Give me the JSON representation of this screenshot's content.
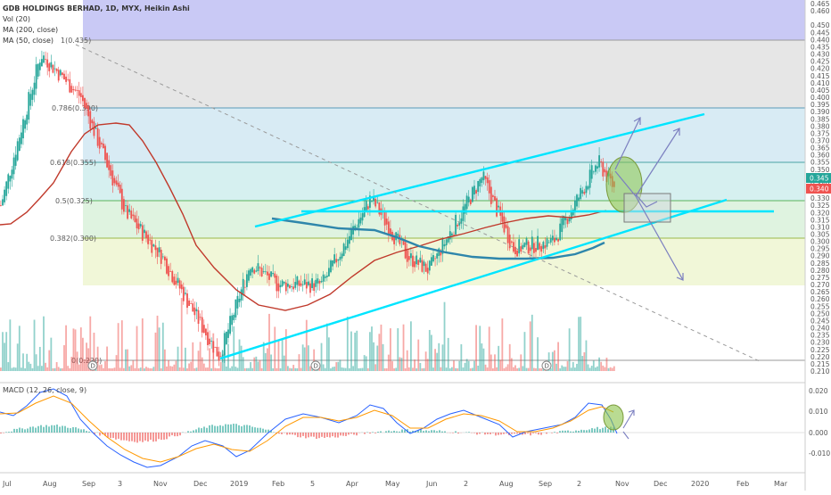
{
  "legend": {
    "title": "GDB HOLDINGS BERHAD, 1D, MYX, Heikin Ashi",
    "vol": "Vol (20)",
    "ma200": "MA (200, close)",
    "ma50": "MA (50, close)"
  },
  "macd_label": "MACD (12, 26, close, 9)",
  "colors": {
    "up": "#26a69a",
    "down": "#ef5350",
    "ma50": "#c0392b",
    "ma200": "#2e86ab",
    "trendline": "#00e5ff",
    "projection_arrow": "#7b7fc0",
    "macd_line": "#2962ff",
    "signal_line": "#ff9800",
    "highlight_ellipse": "#8bc34a"
  },
  "price_axis": {
    "ticks": [
      "0.465",
      "0.460",
      "0.450",
      "0.445",
      "0.440",
      "0.435",
      "0.430",
      "0.425",
      "0.420",
      "0.415",
      "0.410",
      "0.405",
      "0.400",
      "0.395",
      "0.390",
      "0.385",
      "0.380",
      "0.375",
      "0.370",
      "0.365",
      "0.360",
      "0.355",
      "0.350",
      "0.345",
      "0.340",
      "0.335",
      "0.330",
      "0.325",
      "0.320",
      "0.315",
      "0.310",
      "0.305",
      "0.300",
      "0.295",
      "0.290",
      "0.285",
      "0.280",
      "0.275",
      "0.270",
      "0.265",
      "0.260",
      "0.255",
      "0.250",
      "0.245",
      "0.240",
      "0.235",
      "0.230",
      "0.225",
      "0.220",
      "0.215",
      "0.210"
    ],
    "last_price_labels": [
      "0.345",
      "0.340"
    ]
  },
  "macd_axis": {
    "ticks": [
      "0.020",
      "0.010",
      "0.000",
      "-0.010"
    ]
  },
  "time_axis": [
    "Jul",
    "Aug",
    "Sep",
    "3",
    "Nov",
    "Dec",
    "2019",
    "Feb",
    "5",
    "Apr",
    "May",
    "Jun",
    "2",
    "Aug",
    "Sep",
    "2",
    "Nov",
    "Dec",
    "2020",
    "Feb",
    "Mar"
  ],
  "fib_labels": [
    "1(0.435)",
    "0.786(0.390)",
    "0.618(0.355)",
    "0.5(0.325)",
    "0.382(0.300)",
    "0(0.220)"
  ],
  "dividend_marker": "D",
  "chart_data": {
    "type": "line",
    "title": "GDB HOLDINGS BERHAD, 1D, MYX, Heikin Ashi",
    "price_range": [
      0.205,
      0.465
    ],
    "x_months": [
      "Jul 2018",
      "Aug",
      "Sep",
      "Oct",
      "Nov",
      "Dec",
      "Jan 2019",
      "Feb",
      "Mar",
      "Apr",
      "May",
      "Jun",
      "Jul",
      "Aug",
      "Sep",
      "Oct",
      "Nov",
      "Dec",
      "Jan 2020",
      "Feb",
      "Mar"
    ],
    "price_series": [
      {
        "month": "Jul 2018",
        "close": 0.33
      },
      {
        "month": "Aug",
        "close": 0.43
      },
      {
        "month": "Sep",
        "close": 0.37
      },
      {
        "month": "Oct",
        "close": 0.3
      },
      {
        "month": "Nov",
        "close": 0.285
      },
      {
        "month": "Dec",
        "close": 0.225
      },
      {
        "month": "Jan 2019",
        "close": 0.275
      },
      {
        "month": "Feb",
        "close": 0.27
      },
      {
        "month": "Mar",
        "close": 0.285
      },
      {
        "month": "Apr",
        "close": 0.325
      },
      {
        "month": "May",
        "close": 0.285
      },
      {
        "month": "Jun",
        "close": 0.325
      },
      {
        "month": "Jul",
        "close": 0.345
      },
      {
        "month": "Aug",
        "close": 0.3
      },
      {
        "month": "Sep",
        "close": 0.3
      },
      {
        "month": "Oct",
        "close": 0.345
      }
    ],
    "fib_levels": [
      {
        "ratio": "1",
        "price": 0.435
      },
      {
        "ratio": "0.786",
        "price": 0.39
      },
      {
        "ratio": "0.618",
        "price": 0.355
      },
      {
        "ratio": "0.5",
        "price": 0.325
      },
      {
        "ratio": "0.382",
        "price": 0.3
      },
      {
        "ratio": "0",
        "price": 0.22
      }
    ],
    "macd_range": [
      -0.015,
      0.022
    ]
  }
}
